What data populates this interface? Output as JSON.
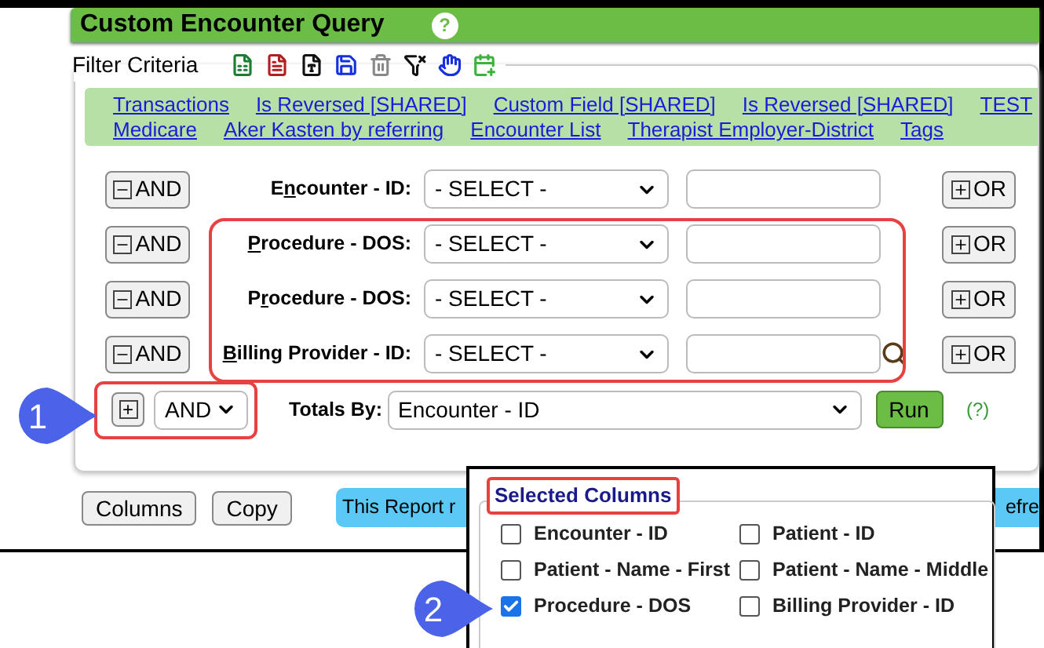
{
  "header": {
    "title": "Custom Encounter Query",
    "help": "?"
  },
  "filter": {
    "legend": "Filter Criteria",
    "saved_queries": [
      {
        "label": "Transactions"
      },
      {
        "label": "Is Reversed [SHARED]"
      },
      {
        "label": "Custom Field [SHARED]"
      },
      {
        "label": "Is Reversed [SHARED]"
      },
      {
        "label": "TEST"
      },
      {
        "label": "Medicare"
      },
      {
        "label": "Aker Kasten by referring"
      },
      {
        "label": "Encounter List"
      },
      {
        "label": "Therapist Employer-District"
      },
      {
        "label": "Tags"
      }
    ],
    "row_groups": [
      {
        "highlighted": false,
        "rows": [
          {
            "remove_button": "AND",
            "label_before": "E",
            "label_key": "n",
            "label_after": "counter - ID:",
            "select": "- SELECT -",
            "lookup": false,
            "or_button": "OR"
          }
        ]
      },
      {
        "highlighted": true,
        "rows": [
          {
            "remove_button": "AND",
            "label_before": "",
            "label_key": "P",
            "label_after": "rocedure - DOS:",
            "select": "- SELECT -",
            "lookup": false,
            "or_button": "OR"
          },
          {
            "remove_button": "AND",
            "label_before": "P",
            "label_key": "r",
            "label_after": "ocedure - DOS:",
            "select": "- SELECT -",
            "lookup": false,
            "or_button": "OR"
          },
          {
            "remove_button": "AND",
            "label_before": "",
            "label_key": "B",
            "label_after": "illing Provider - ID:",
            "select": "- SELECT -",
            "lookup": true,
            "or_button": "OR"
          }
        ]
      }
    ],
    "add_button": "+",
    "operator": "AND",
    "operator_highlighted": true,
    "totals_label": "Totals By:",
    "totals_select": "Encounter - ID",
    "run_button": "Run",
    "run_help": "(?)"
  },
  "footer": {
    "buttons": [
      "Columns",
      "Copy"
    ],
    "banner_start": "This Report r",
    "banner_end": "efre"
  },
  "selected_columns": {
    "legend": "Selected Columns",
    "legend_highlighted": true,
    "columns": [
      {
        "label": "Encounter - ID",
        "checked": false
      },
      {
        "label": "Patient - ID",
        "checked": false
      },
      {
        "label": "Patient - Name - First",
        "checked": false
      },
      {
        "label": "Patient - Name - Middle",
        "checked": false
      },
      {
        "label": "Procedure -  **DOS**",
        "checked": true
      },
      {
        "label": "Billing Provider - ID",
        "checked": false
      }
    ]
  },
  "callouts": [
    {
      "number": "1"
    },
    {
      "number": "2"
    }
  ]
}
